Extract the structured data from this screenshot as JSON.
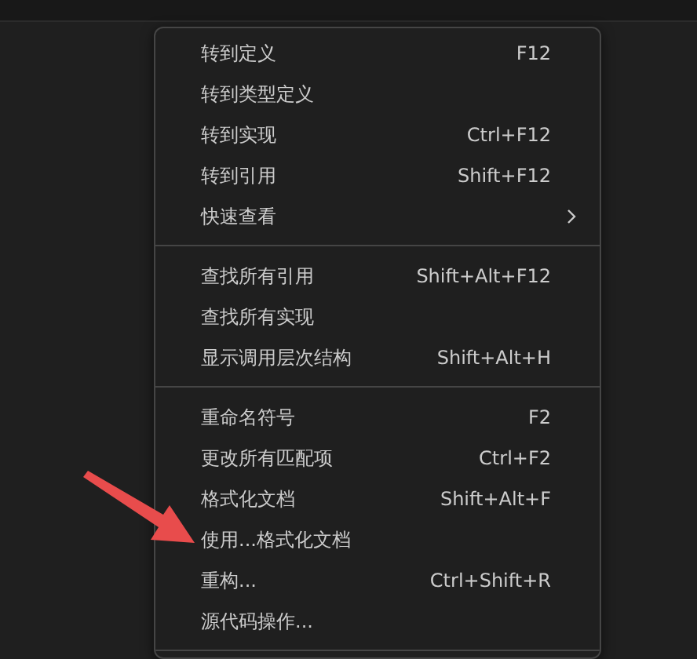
{
  "context_menu": {
    "continues_below": true,
    "groups": [
      {
        "items": [
          {
            "label": "转到定义",
            "shortcut": "F12",
            "submenu": false
          },
          {
            "label": "转到类型定义",
            "submenu": false
          },
          {
            "label": "转到实现",
            "shortcut": "Ctrl+F12",
            "submenu": false
          },
          {
            "label": "转到引用",
            "shortcut": "Shift+F12",
            "submenu": false
          },
          {
            "label": "快速查看",
            "submenu": true
          }
        ]
      },
      {
        "items": [
          {
            "label": "查找所有引用",
            "shortcut": "Shift+Alt+F12",
            "submenu": false
          },
          {
            "label": "查找所有实现",
            "submenu": false
          },
          {
            "label": "显示调用层次结构",
            "shortcut": "Shift+Alt+H",
            "submenu": false
          }
        ]
      },
      {
        "items": [
          {
            "label": "重命名符号",
            "shortcut": "F2",
            "submenu": false
          },
          {
            "label": "更改所有匹配项",
            "shortcut": "Ctrl+F2",
            "submenu": false
          },
          {
            "label": "格式化文档",
            "shortcut": "Shift+Alt+F",
            "submenu": false
          },
          {
            "label": "使用...格式化文档",
            "submenu": false
          },
          {
            "label": "重构...",
            "shortcut": "Ctrl+Shift+R",
            "submenu": false
          },
          {
            "label": "源代码操作...",
            "submenu": false
          }
        ]
      }
    ]
  }
}
